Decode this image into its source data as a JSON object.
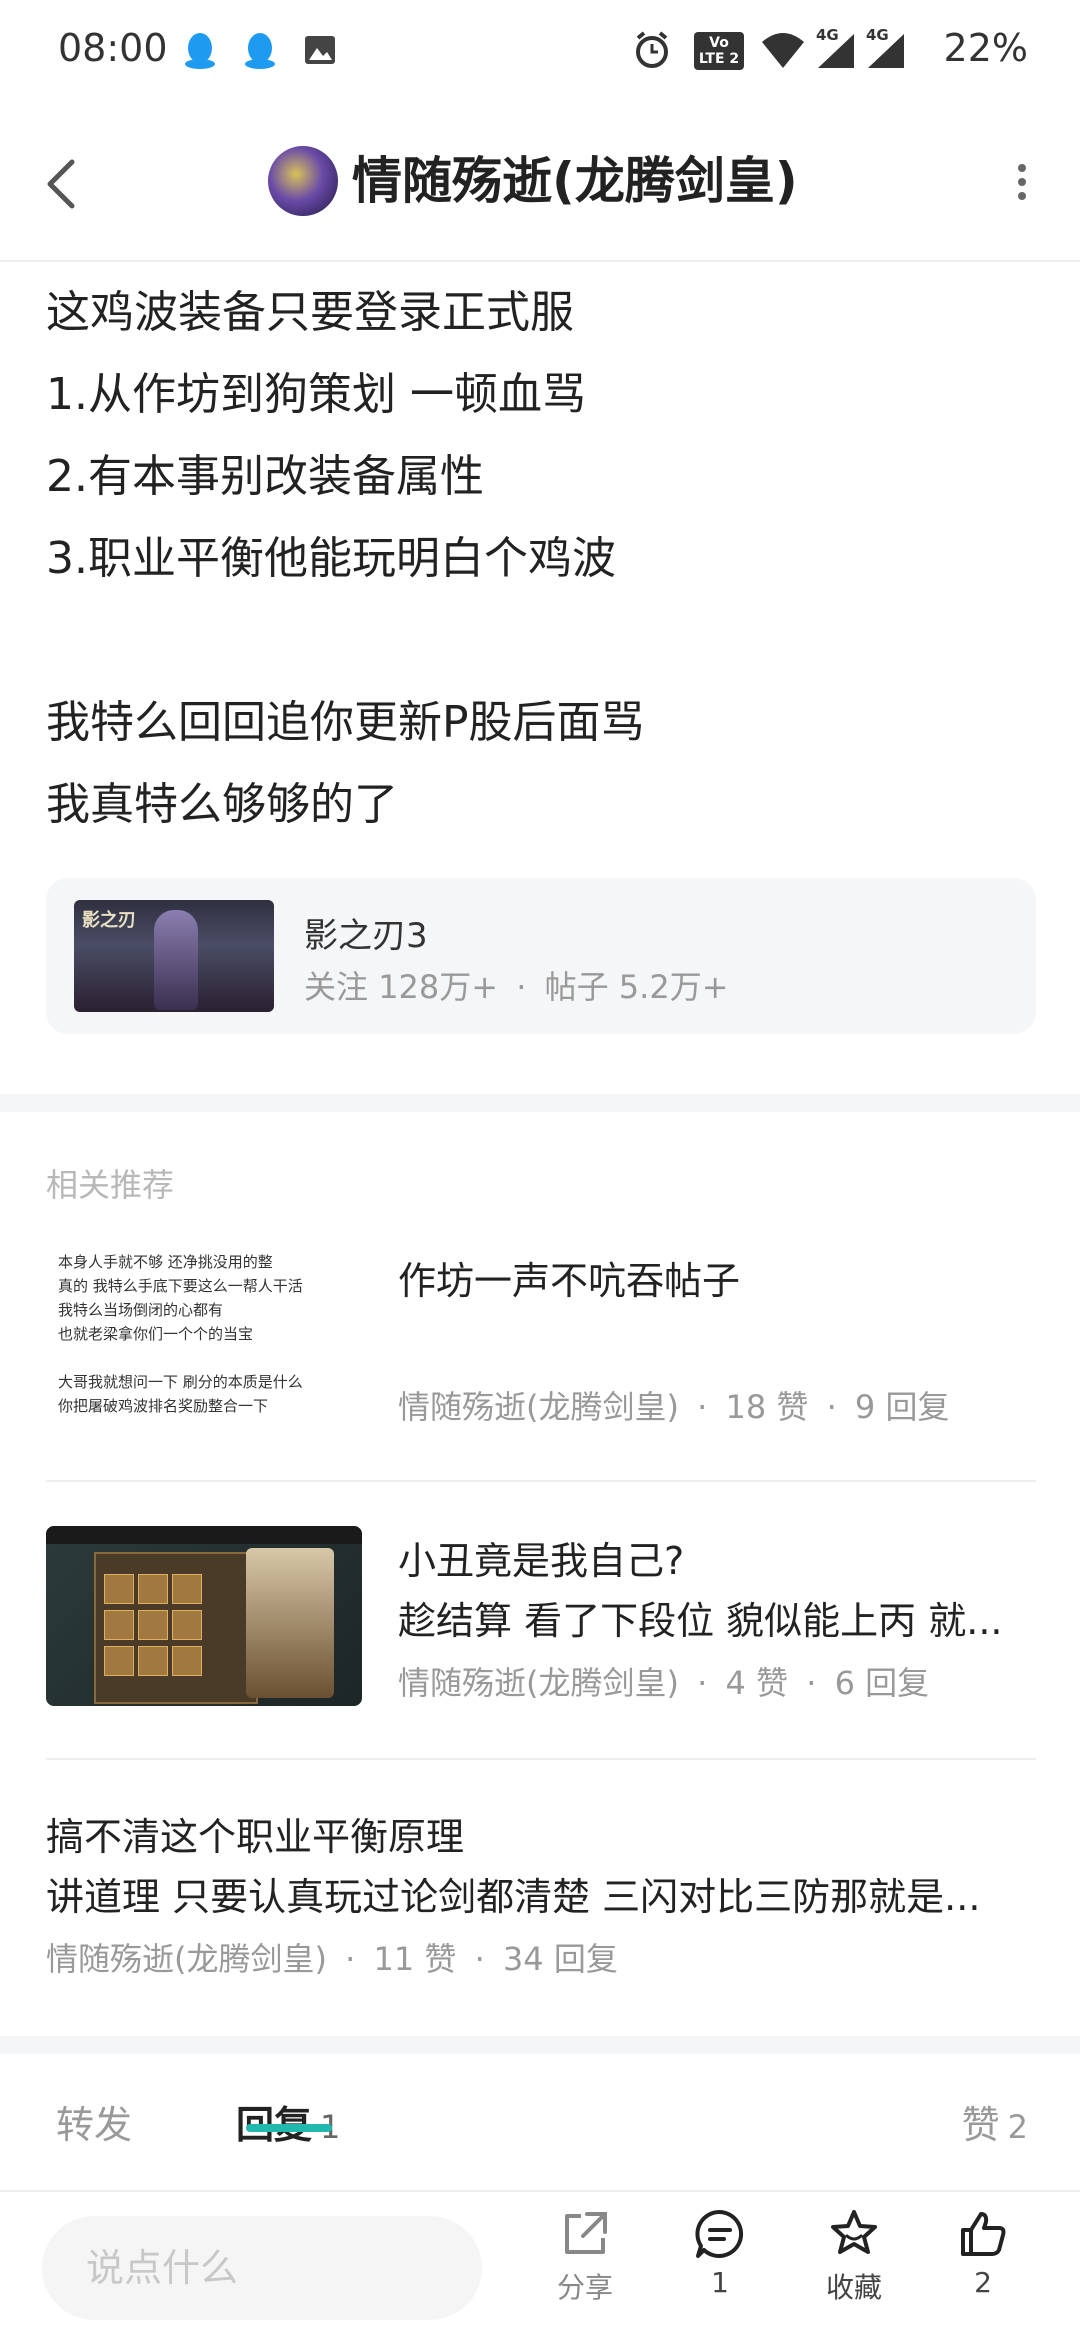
{
  "status_bar": {
    "time": "08:00",
    "battery": "22%",
    "icons": [
      "qq-icon",
      "qq-icon",
      "gallery-icon",
      "alarm-icon",
      "volte-icon",
      "wifi-icon",
      "signal-4g-icon",
      "signal-4g-icon"
    ],
    "network_label": "4G",
    "volte_label": "Vo LTE 2"
  },
  "header": {
    "title": "情随殇逝(龙腾剑皇)"
  },
  "post": {
    "lines": [
      "这鸡波装备只要登录正式服",
      "1.从作坊到狗策划 一顿血骂",
      "2.有本事别改装备属性",
      "3.职业平衡他能玩明白个鸡波",
      "",
      "我特么回回追你更新P股后面骂",
      "我真特么够够的了"
    ]
  },
  "forum": {
    "name": "影之刃3",
    "follow_label": "关注",
    "follow_count": "128万+",
    "dot": "·",
    "posts_label": "帖子",
    "posts_count": "5.2万+",
    "thumb_logo": "影之刃"
  },
  "related": {
    "label": "相关推荐",
    "items": [
      {
        "title": "作坊一声不吭吞帖子",
        "snippet": "",
        "author": "情随殇逝(龙腾剑皇)",
        "likes": "18 赞",
        "replies": "9 回复",
        "thumb_lines": [
          "本身人手就不够 还净挑没用的整",
          "真的 我特么手底下要这么一帮人干活",
          "我特么当场倒闭的心都有",
          "也就老梁拿你们一个个的当宝",
          "",
          "大哥我就想问一下 刷分的本质是什么",
          "你把屠破鸡波排名奖励整合一下"
        ]
      },
      {
        "title": "小丑竟是我自己?",
        "snippet": "趁结算 看了下段位 貌似能上丙 就...",
        "author": "情随殇逝(龙腾剑皇)",
        "likes": "4 赞",
        "replies": "6 回复"
      },
      {
        "title": "搞不清这个职业平衡原理",
        "snippet": "讲道理 只要认真玩过论剑都清楚 三闪对比三防那就是...",
        "author": "情随殇逝(龙腾剑皇)",
        "likes": "11 赞",
        "replies": "34 回复"
      }
    ]
  },
  "tabs": {
    "repost": "转发",
    "reply": "回复",
    "reply_count": "1",
    "like": "赞",
    "like_count": "2"
  },
  "bottom_bar": {
    "input_placeholder": "说点什么",
    "share_label": "分享",
    "comment_count": "1",
    "favorite_label": "收藏",
    "like_count": "2"
  },
  "colors": {
    "accent": "#22b8b0",
    "separator": "#f4f5f6",
    "muted_text": "#999999"
  }
}
